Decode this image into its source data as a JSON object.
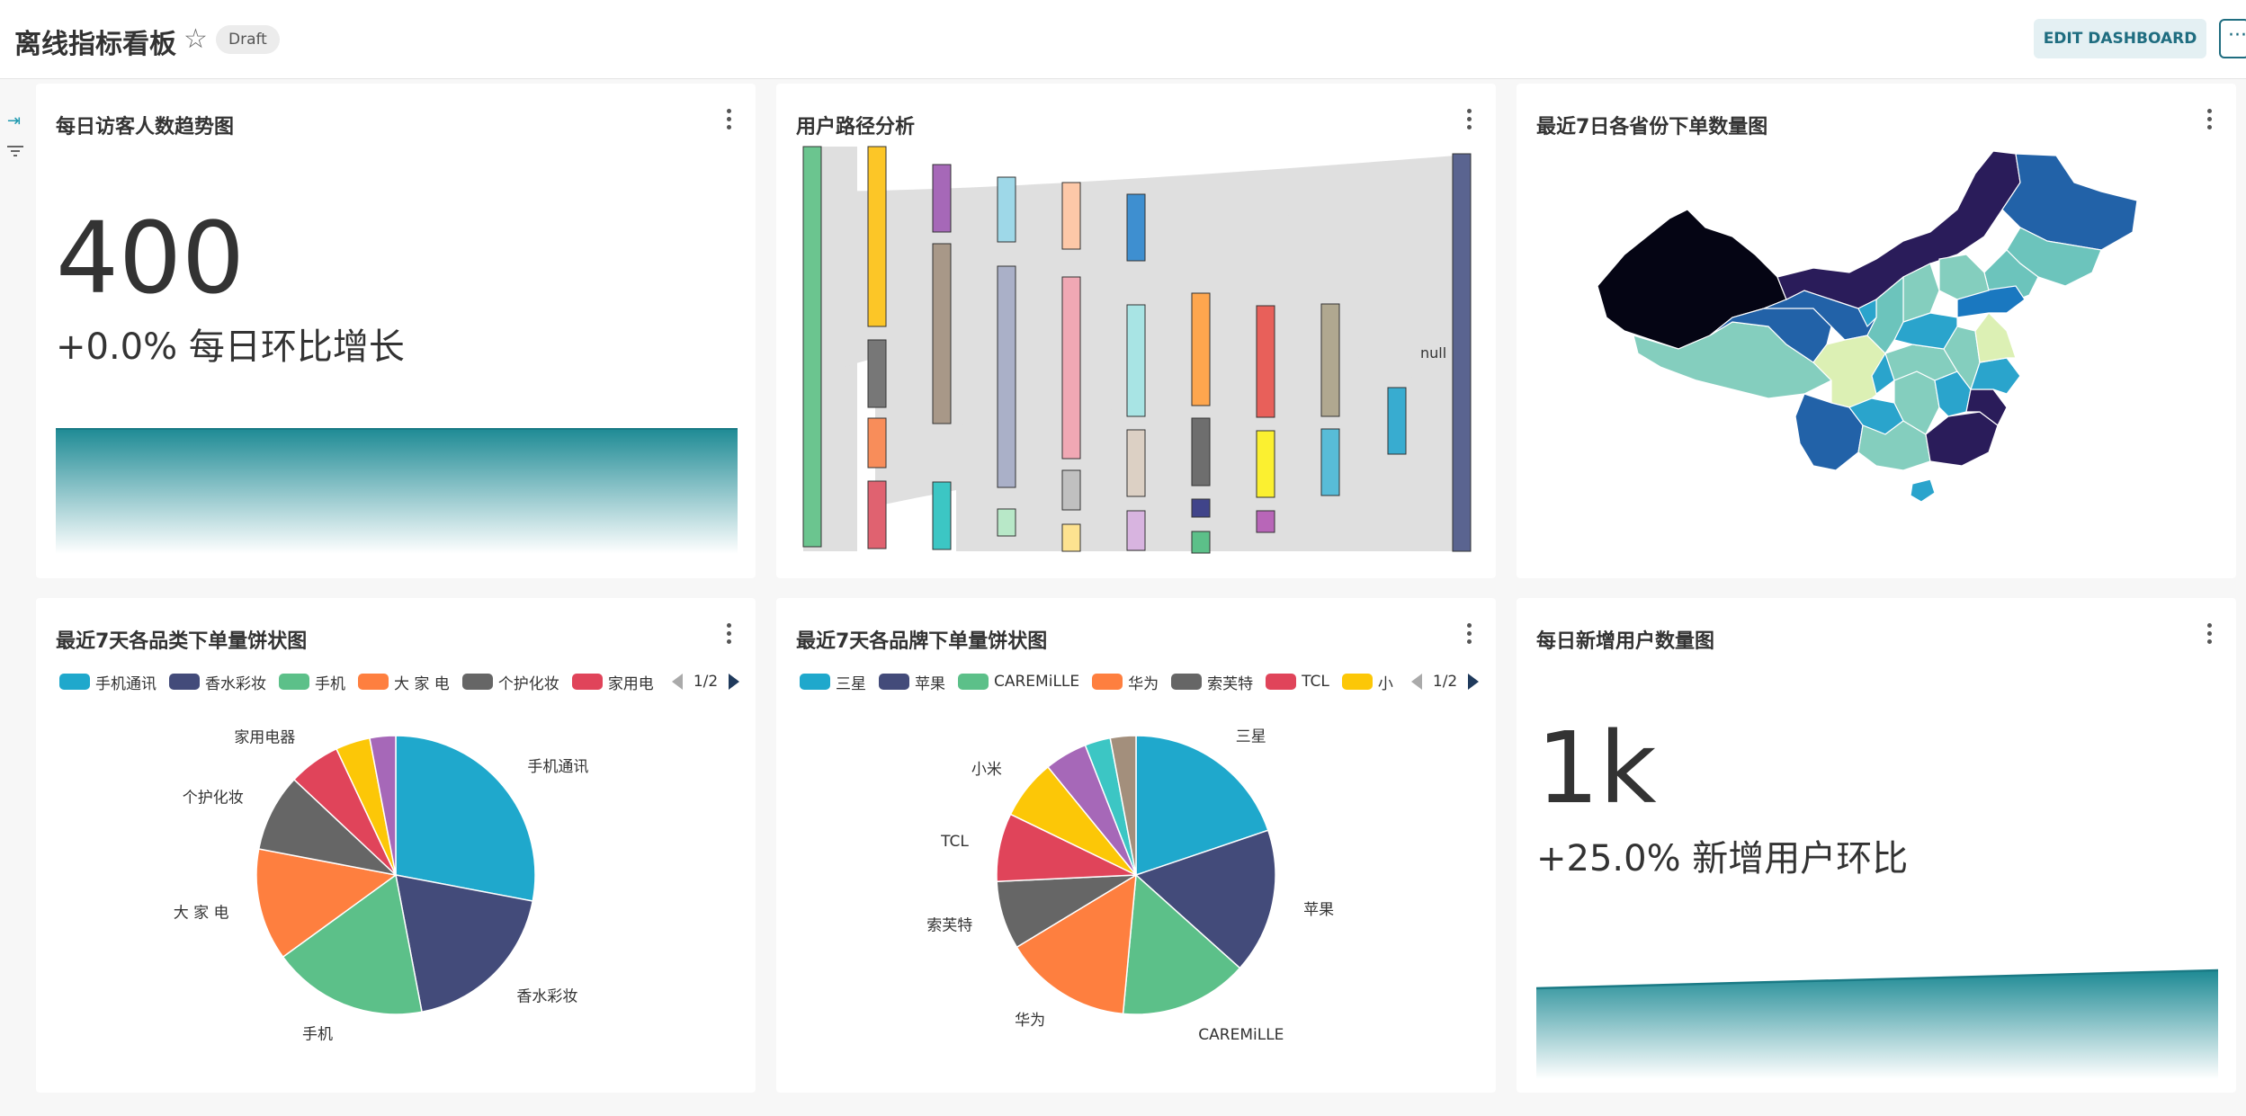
{
  "header": {
    "title": "离线指标看板",
    "status_badge": "Draft",
    "edit_label": "EDIT DASHBOARD",
    "more_label": "···"
  },
  "sidebar": {
    "icons": [
      "expand-icon",
      "filter-icon"
    ]
  },
  "cards": {
    "daily_visitors": {
      "title": "每日访客人数趋势图",
      "big_number": "400",
      "subheader": "+0.0% 每日环比增长",
      "trendline": [
        400,
        400
      ]
    },
    "user_path": {
      "title": "用户路径分析",
      "null_label": "null"
    },
    "province_map": {
      "title": "最近7日各省份下单数量图"
    },
    "category_pie": {
      "title": "最近7天各品类下单量饼状图",
      "legend_page": "1/2"
    },
    "brand_pie": {
      "title": "最近7天各品牌下单量饼状图",
      "legend_page": "1/2"
    },
    "new_users": {
      "title": "每日新增用户数量图",
      "big_number": "1k",
      "subheader": "+25.0% 新增用户环比",
      "trendline": [
        800,
        1000
      ]
    }
  },
  "chart_data": [
    {
      "type": "pie",
      "chart": "category_pie",
      "legend": [
        "手机通讯",
        "香水彩妆",
        "手机",
        "大 家 电",
        "个护化妆",
        "家用电"
      ],
      "slices": [
        {
          "label": "手机通讯",
          "value": 28,
          "color": "#1fa8cc"
        },
        {
          "label": "香水彩妆",
          "value": 19,
          "color": "#434b7a"
        },
        {
          "label": "手机",
          "value": 18,
          "color": "#5cc089"
        },
        {
          "label": "大 家 电",
          "value": 13,
          "color": "#fe7f3f"
        },
        {
          "label": "个护化妆",
          "value": 9,
          "color": "#666666"
        },
        {
          "label": "家用电器",
          "value": 6,
          "color": "#e0445a"
        },
        {
          "label": "",
          "value": 4,
          "color": "#fcc707"
        },
        {
          "label": "",
          "value": 3,
          "color": "#a668b8"
        }
      ]
    },
    {
      "type": "pie",
      "chart": "brand_pie",
      "legend": [
        "三星",
        "苹果",
        "CAREMiLLE",
        "华为",
        "索芙特",
        "TCL",
        "小"
      ],
      "slices": [
        {
          "label": "三星",
          "value": 20,
          "color": "#1fa8cc"
        },
        {
          "label": "苹果",
          "value": 17,
          "color": "#434b7a"
        },
        {
          "label": "CAREMiLLE",
          "value": 15,
          "color": "#5cc089"
        },
        {
          "label": "华为",
          "value": 15,
          "color": "#fe7f3f"
        },
        {
          "label": "索芙特",
          "value": 8,
          "color": "#666666"
        },
        {
          "label": "TCL",
          "value": 8,
          "color": "#e0445a"
        },
        {
          "label": "小米",
          "value": 7,
          "color": "#fcc707"
        },
        {
          "label": "",
          "value": 5,
          "color": "#a668b8"
        },
        {
          "label": "",
          "value": 3,
          "color": "#3cc6c4"
        },
        {
          "label": "",
          "value": 3,
          "color": "#a38f7c"
        }
      ]
    }
  ]
}
